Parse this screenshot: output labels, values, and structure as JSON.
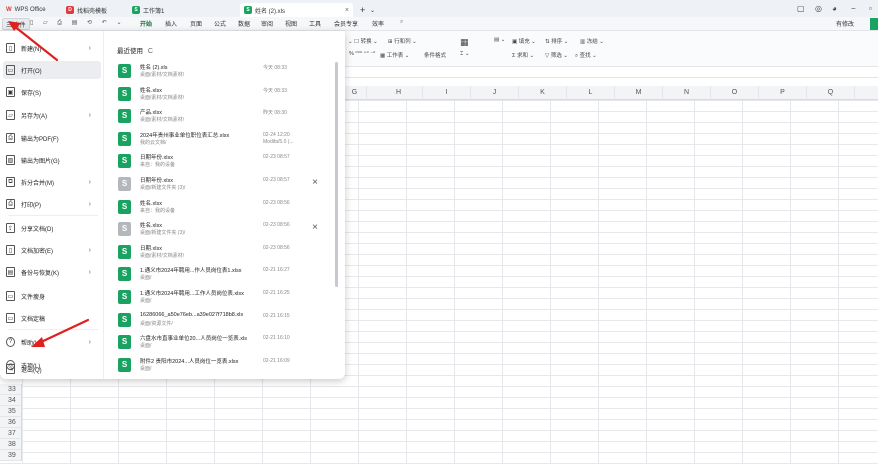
{
  "titlebar": {
    "app": "WPS Office",
    "tabs": [
      "找稻壳模板",
      "工作簿1",
      "姓名 (2).xls"
    ],
    "add_tab": "+",
    "dropdown": "⌄"
  },
  "menu": {
    "file": "三 文件",
    "items": [
      "开始",
      "插入",
      "页面",
      "公式",
      "数据",
      "审阅",
      "视图",
      "工具",
      "会员专享",
      "效率"
    ],
    "share": "有修改"
  },
  "ribbon": {
    "items": [
      "转换",
      "行和列",
      "工作表",
      "条件格式",
      "填充",
      "排序",
      "冻结",
      "求和",
      "筛选",
      "查找"
    ]
  },
  "columns": [
    "H",
    "I",
    "J",
    "K",
    "L",
    "M",
    "N",
    "O",
    "P",
    "Q"
  ],
  "rows": [
    "33",
    "34",
    "35",
    "36",
    "37",
    "38",
    "39"
  ],
  "filemenu": {
    "nav": [
      {
        "label": "新建(N)",
        "chevron": true
      },
      {
        "label": "打开(O)",
        "chevron": false
      },
      {
        "label": "保存(S)",
        "chevron": false
      },
      {
        "label": "另存为(A)",
        "chevron": true
      },
      {
        "label": "输出为PDF(F)",
        "chevron": false
      },
      {
        "label": "输出为图片(G)",
        "chevron": false
      },
      {
        "label": "拆分合并(M)",
        "chevron": true
      },
      {
        "label": "打印(P)",
        "chevron": true
      },
      {
        "label": "分享文档(D)",
        "chevron": false
      },
      {
        "label": "文档加密(E)",
        "chevron": true
      },
      {
        "label": "备份与恢复(K)",
        "chevron": true
      },
      {
        "label": "文件瘦身",
        "chevron": false
      },
      {
        "label": "文档定稿",
        "chevron": false
      },
      {
        "label": "帮助(H)",
        "chevron": true
      },
      {
        "label": "选项(L)",
        "chevron": false
      },
      {
        "label": "退出(Q)",
        "chevron": false
      }
    ],
    "recent_title": "最近使用",
    "refresh_icon": "C",
    "recent": [
      {
        "name": "姓名 (2).xls",
        "path": "桌面/素材/文档素材/",
        "date": "今天 08:33",
        "date2": "",
        "gray": false,
        "close": false
      },
      {
        "name": "姓名.xlsx",
        "path": "桌面/素材/文档素材/",
        "date": "今天 08:33",
        "date2": "",
        "gray": false,
        "close": false
      },
      {
        "name": "产品.xlsx",
        "path": "桌面/素材/文档素材/",
        "date": "昨天 08:30",
        "date2": "",
        "gray": false,
        "close": false
      },
      {
        "name": "2024年贵州事业单位职位表汇总.xlsx",
        "path": "我的云文档/",
        "date": "02-24 12:20",
        "date2": "Modifa/5.0 (...",
        "gray": false,
        "close": false
      },
      {
        "name": "日期年份.xlsx",
        "path": "来自：我的设备",
        "date": "02-23 08:57",
        "date2": "",
        "gray": false,
        "close": false
      },
      {
        "name": "日期年份.xlsx",
        "path": "桌面/新建文件夹 (3)/",
        "date": "02-23 08:57",
        "date2": "",
        "gray": true,
        "close": true
      },
      {
        "name": "姓名.xlsx",
        "path": "来自：我的设备",
        "date": "02-23 08:56",
        "date2": "",
        "gray": false,
        "close": false
      },
      {
        "name": "姓名.xlsx",
        "path": "桌面/新建文件夹 (3)/",
        "date": "02-23 08:56",
        "date2": "",
        "gray": true,
        "close": true
      },
      {
        "name": "日期.xlsx",
        "path": "桌面/素材/文档素材/",
        "date": "02-23 08:56",
        "date2": "",
        "gray": false,
        "close": false
      },
      {
        "name": "1.通义市2024年聘用...作人员岗位表1.xlsx",
        "path": "桌面/",
        "date": "02-21 16:27",
        "date2": "",
        "gray": false,
        "close": false
      },
      {
        "name": "1.通义市2024年聘用...工作人员岗位表.xlsx",
        "path": "桌面/",
        "date": "02-21 16:25",
        "date2": "",
        "gray": false,
        "close": false
      },
      {
        "name": "16286066_a50e76eb...a39e027f718b8.xls",
        "path": "桌面/资源文件/",
        "date": "02-21 16:15",
        "date2": "",
        "gray": false,
        "close": false
      },
      {
        "name": "六盘水市直事业单位20...人员岗位一览表.xls",
        "path": "桌面/",
        "date": "02-21 16:10",
        "date2": "",
        "gray": false,
        "close": false
      },
      {
        "name": "附件2 贵阳市2024...人员岗位一览表.xlsx",
        "path": "桌面/",
        "date": "02-21 16:09",
        "date2": "",
        "gray": false,
        "close": false
      }
    ]
  },
  "colors": {
    "accent_green": "#1aa260",
    "annotation_red": "#e02020"
  }
}
